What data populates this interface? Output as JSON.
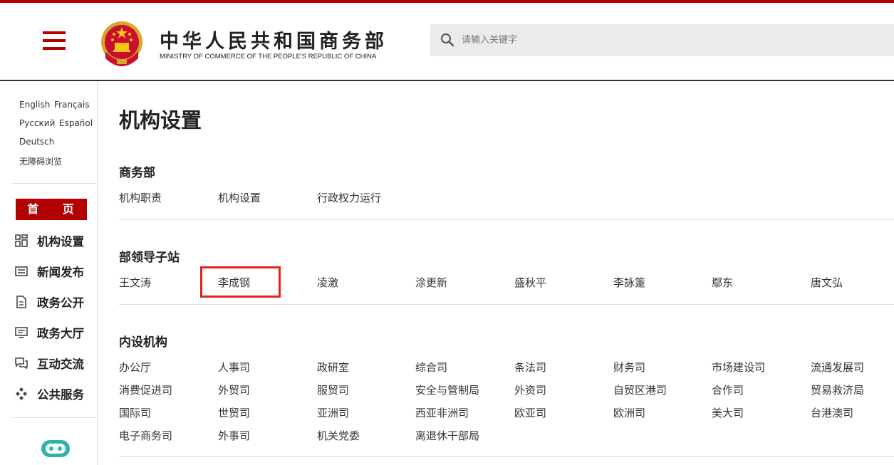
{
  "header": {
    "title": "中华人民共和国商务部",
    "subtitle": "MINISTRY OF COMMERCE OF THE PEOPLE'S REPUBLIC OF CHINA",
    "search_placeholder": "请输入关键字",
    "menu_icon": "hamburger-icon",
    "search_icon": "search-icon",
    "emblem_icon": "national-emblem-icon"
  },
  "colors": {
    "brand_red": "#b30000",
    "highlight": "#e32219"
  },
  "sidebar": {
    "languages": [
      "English",
      "Français",
      "Русский",
      "Español",
      "Deutsch",
      "无障碍浏览"
    ],
    "home_label": "首 页",
    "nav": [
      {
        "label": "机构设置",
        "icon": "grid-icon"
      },
      {
        "label": "新闻发布",
        "icon": "news-icon"
      },
      {
        "label": "政务公开",
        "icon": "document-icon"
      },
      {
        "label": "政务大厅",
        "icon": "monitor-icon"
      },
      {
        "label": "互动交流",
        "icon": "chat-icon"
      },
      {
        "label": "公共服务",
        "icon": "service-icon"
      }
    ],
    "chatbot_icon": "robot-icon"
  },
  "main": {
    "page_title": "机构设置",
    "sections": [
      {
        "title": "商务部",
        "links": [
          "机构职责",
          "机构设置",
          "行政权力运行"
        ]
      },
      {
        "title": "部领导子站",
        "links": [
          "王文涛",
          "李成钢",
          "凌激",
          "涂更新",
          "盛秋平",
          "李詠箑",
          "鄢东",
          "唐文弘"
        ]
      },
      {
        "title": "内设机构",
        "links": [
          "办公厅",
          "人事司",
          "政研室",
          "综合司",
          "条法司",
          "财务司",
          "市场建设司",
          "流通发展司",
          "消费促进司",
          "外贸司",
          "服贸司",
          "安全与管制局",
          "外资司",
          "自贸区港司",
          "合作司",
          "贸易救济局",
          "国际司",
          "世贸司",
          "亚洲司",
          "西亚非洲司",
          "欧亚司",
          "欧洲司",
          "美大司",
          "台港澳司",
          "电子商务司",
          "外事司",
          "机关党委",
          "离退休干部局"
        ]
      }
    ]
  }
}
